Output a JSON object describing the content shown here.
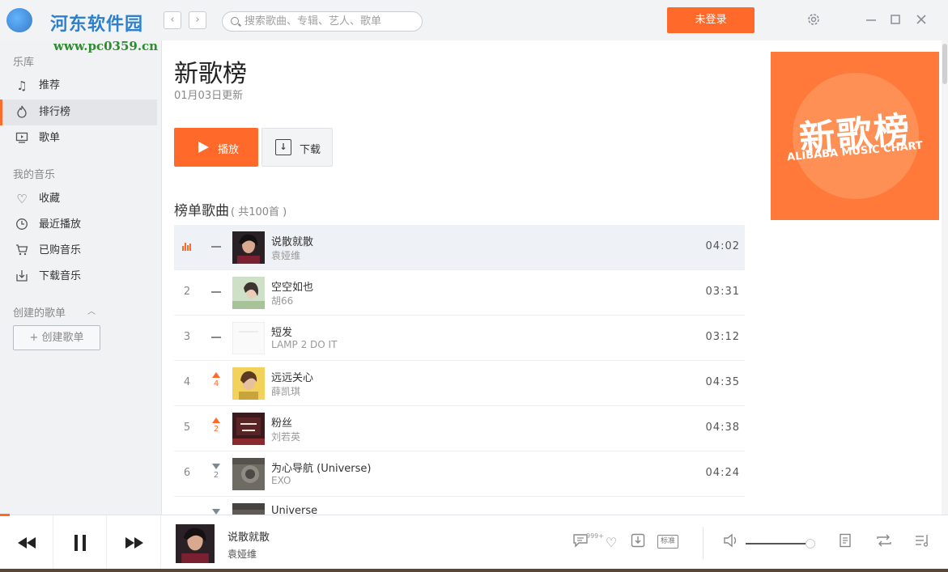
{
  "topbar": {
    "watermark_title": "河东软件园",
    "watermark_url": "www.pc0359.cn",
    "back_glyph": "‹",
    "forward_glyph": "›",
    "search_placeholder": "搜索歌曲、专辑、艺人、歌单",
    "login_label": "未登录",
    "icons": [
      "settings-icon",
      "minimize-icon",
      "maximize-icon",
      "close-icon"
    ]
  },
  "sidebar": {
    "library_title": "乐库",
    "library_items": [
      {
        "label": "推荐",
        "icon": "music-note-icon"
      },
      {
        "label": "排行榜",
        "icon": "flame-icon",
        "active": true
      },
      {
        "label": "歌单",
        "icon": "playlist-icon"
      }
    ],
    "my_music_title": "我的音乐",
    "my_music_items": [
      {
        "label": "收藏",
        "icon": "heart-icon"
      },
      {
        "label": "最近播放",
        "icon": "clock-icon"
      },
      {
        "label": "已购音乐",
        "icon": "cart-icon"
      },
      {
        "label": "下载音乐",
        "icon": "download-icon"
      }
    ],
    "created_title": "创建的歌单",
    "create_button": "+ 创建歌单"
  },
  "chart": {
    "title": "新歌榜",
    "updated": "01月03日更新",
    "play_label": "播放",
    "download_label": "下载",
    "list_title": "榜单歌曲",
    "list_count": "( 共100首 )",
    "cover_title": "新歌榜",
    "cover_subtitle": "ALIBABA MUSIC CHART",
    "accent_color": "#ff6a2b"
  },
  "songs": [
    {
      "rank": "",
      "playing": true,
      "trend": "flat",
      "change": "",
      "title": "说散就散",
      "artist": "袁娅维",
      "duration": "04:02"
    },
    {
      "rank": "2",
      "trend": "flat",
      "change": "",
      "title": "空空如也",
      "artist": "胡66",
      "duration": "03:31"
    },
    {
      "rank": "3",
      "trend": "flat",
      "change": "",
      "title": "短发",
      "artist": "LAMP 2 DO IT",
      "duration": "03:12"
    },
    {
      "rank": "4",
      "trend": "up",
      "change": "4",
      "title": "远远关心",
      "artist": "薛凯琪",
      "duration": "04:35"
    },
    {
      "rank": "5",
      "trend": "up",
      "change": "2",
      "title": "粉丝",
      "artist": "刘若英",
      "duration": "04:38"
    },
    {
      "rank": "6",
      "trend": "down",
      "change": "2",
      "title": "为心导航 (Universe)",
      "artist": "EXO",
      "duration": "04:24"
    },
    {
      "rank": "",
      "trend": "down",
      "change": "",
      "title": "Universe",
      "artist": "",
      "duration": ""
    }
  ],
  "player": {
    "song": "说散就散",
    "artist": "袁娅维",
    "comment_badge": "999+",
    "quality_label": "标准",
    "volume_fraction": 0.95,
    "progress_fraction": 0.01
  }
}
